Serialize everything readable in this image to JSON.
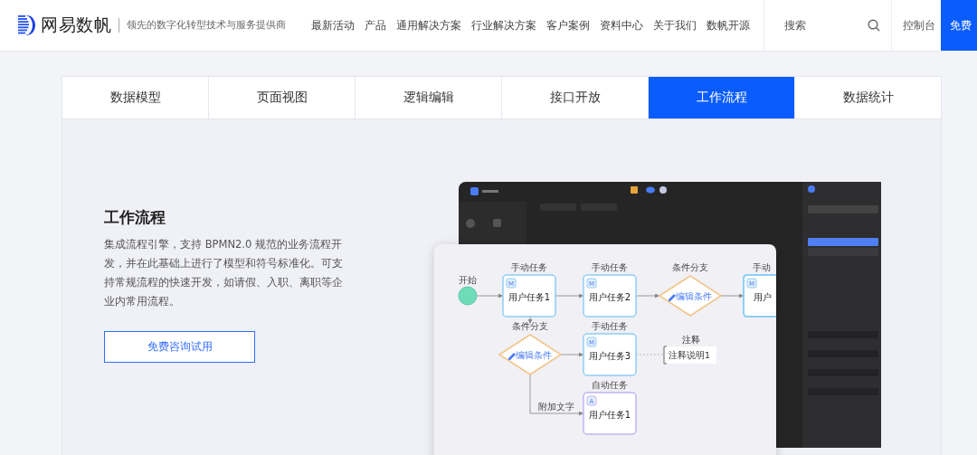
{
  "header": {
    "brand": "网易数帆",
    "tagline": "领先的数字化转型技术与服务提供商",
    "nav": [
      "最新活动",
      "产品",
      "通用解决方案",
      "行业解决方案",
      "客户案例",
      "资料中心",
      "关于我们",
      "数帆开源"
    ],
    "search": {
      "placeholder": "搜索"
    },
    "console": "控制台",
    "cta": "免费"
  },
  "tabs": [
    {
      "label": "数据模型",
      "selected": false
    },
    {
      "label": "页面视图",
      "selected": false
    },
    {
      "label": "逻辑编辑",
      "selected": false
    },
    {
      "label": "接口开放",
      "selected": false
    },
    {
      "label": "工作流程",
      "selected": true
    },
    {
      "label": "数据统计",
      "selected": false
    }
  ],
  "feature": {
    "title": "工作流程",
    "description": "集成流程引擎，支持 BPMN2.0 规范的业务流程开发，并在此基础上进行了模型和符号标准化。可支持常规流程的快速开发，如请假、入职、离职等企业内常用流程。",
    "button": "免费咨询试用"
  },
  "flowchart": {
    "nodes": [
      {
        "kind": "start",
        "caption": "开始"
      },
      {
        "kind": "task",
        "caption": "手动任务",
        "label": "用户任务1",
        "badge": "M",
        "color": "#8fcdf5"
      },
      {
        "kind": "task",
        "caption": "手动任务",
        "label": "用户任务2",
        "badge": "M",
        "color": "#8fcdf5"
      },
      {
        "kind": "gateway",
        "caption": "条件分支",
        "label": "编辑条件"
      },
      {
        "kind": "task",
        "caption": "手动",
        "label": "用户",
        "badge": "M",
        "color": "#8fcdf5"
      },
      {
        "kind": "gateway",
        "caption": "条件分支",
        "label": "编辑条件"
      },
      {
        "kind": "task",
        "caption": "手动任务",
        "label": "用户任务3",
        "badge": "M",
        "color": "#8fcdf5"
      },
      {
        "kind": "note",
        "caption": "注释",
        "label": "注释说明1"
      },
      {
        "kind": "task",
        "caption": "自动任务",
        "label": "用户任务1",
        "badge": "A",
        "color": "#c3b3f0"
      }
    ],
    "edge_label": "附加文字"
  }
}
